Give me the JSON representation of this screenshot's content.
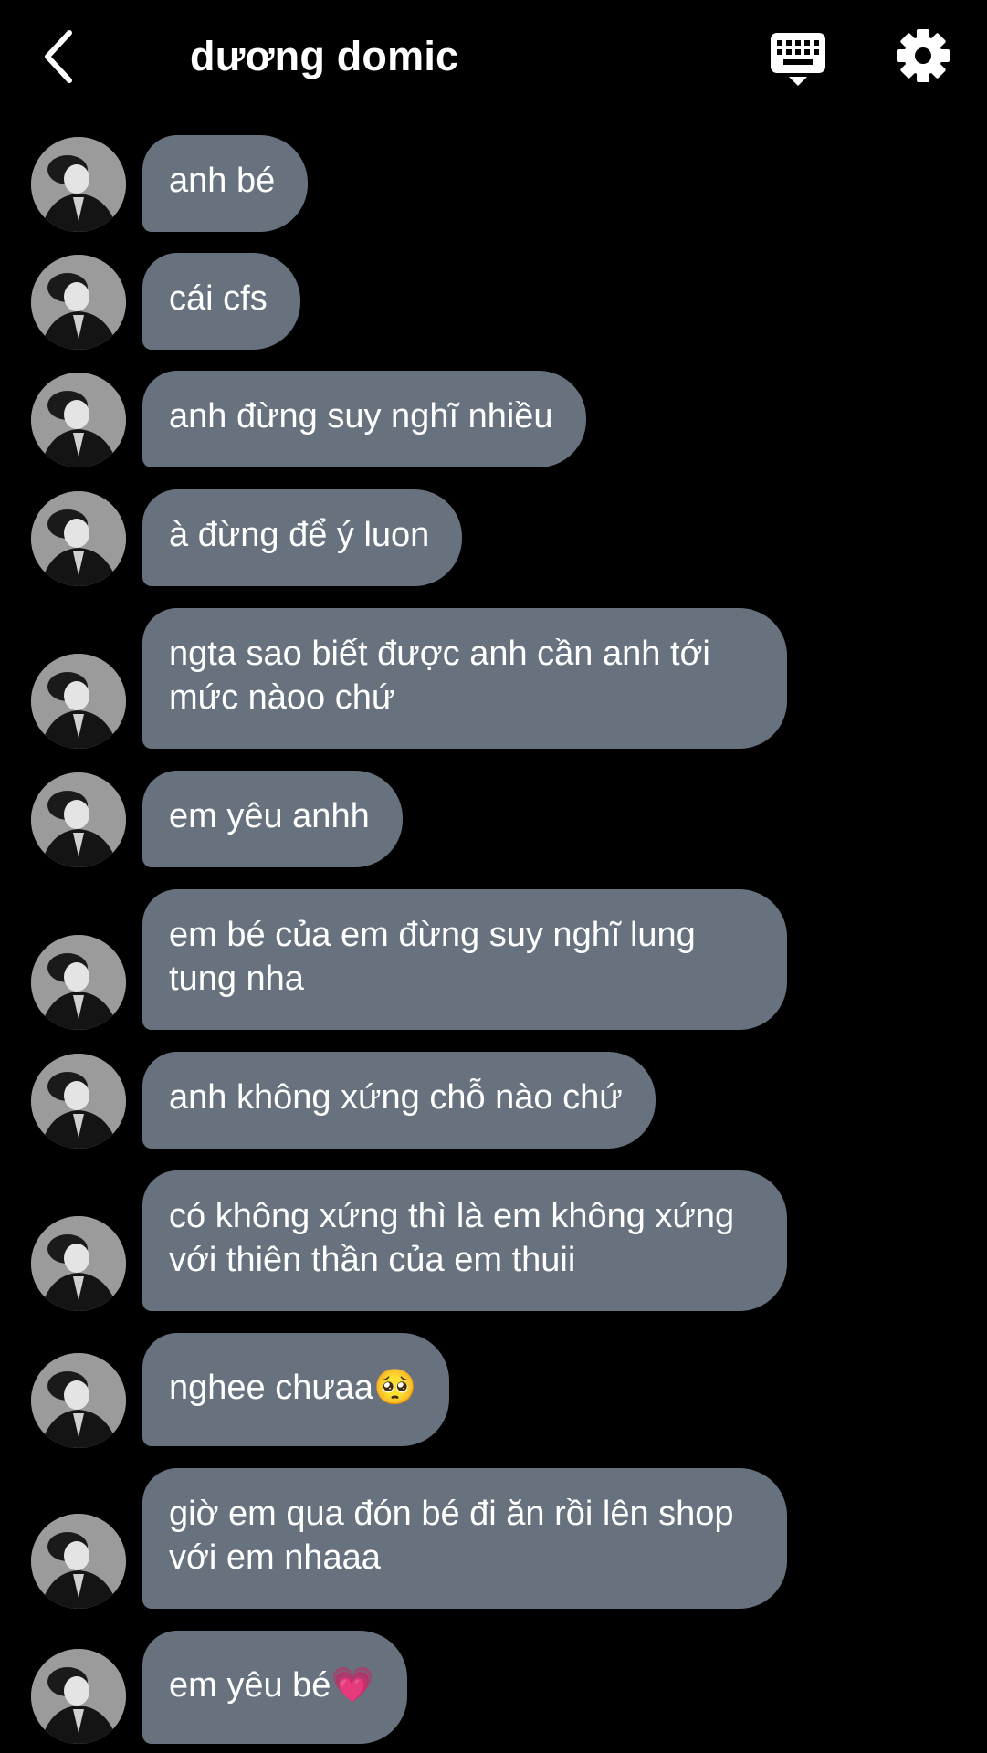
{
  "header": {
    "contact_name": "dương domic",
    "back_icon": "chevron-left-icon",
    "keyboard_icon": "keyboard-hide-icon",
    "settings_icon": "gear-icon"
  },
  "theme": {
    "background": "#000000",
    "bubble_color": "#67727e",
    "text_color": "#ffffff"
  },
  "messages": [
    {
      "text": "anh bé"
    },
    {
      "text": "cái cfs"
    },
    {
      "text": "anh đừng suy nghĩ nhiều"
    },
    {
      "text": "à đừng để ý luon"
    },
    {
      "text": "ngta sao biết được anh cần anh tới mức nàoo chứ"
    },
    {
      "text": "em yêu anhh"
    },
    {
      "text": "em bé của em đừng suy nghĩ lung tung nha"
    },
    {
      "text": "anh không xứng chỗ nào chứ"
    },
    {
      "text": "có không xứng thì là em không xứng với thiên thần của em thuii"
    },
    {
      "text": "nghee chưaa🥺"
    },
    {
      "text": "giờ em qua đón bé đi ăn rồi lên shop với em nhaaa"
    },
    {
      "text": "em yêu bé💗"
    }
  ]
}
